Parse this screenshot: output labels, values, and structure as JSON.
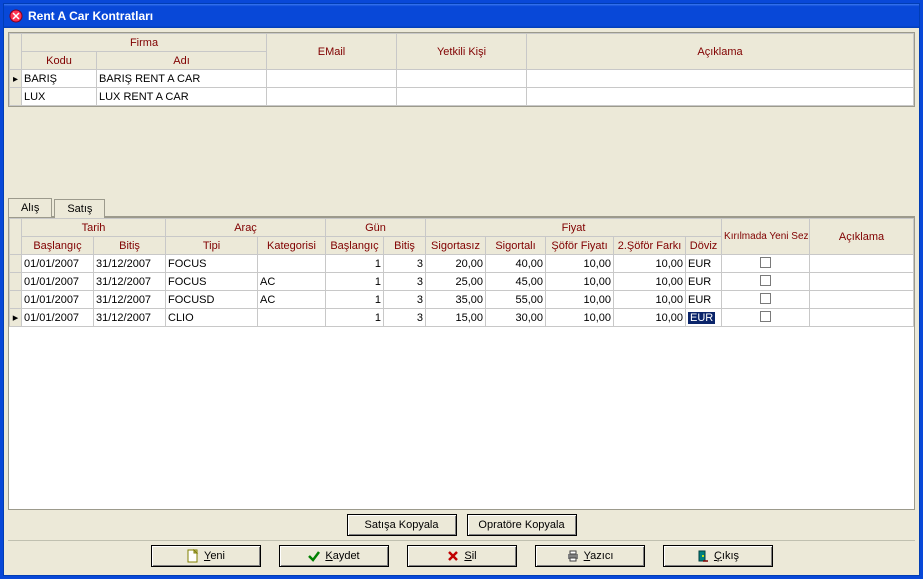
{
  "window": {
    "title": "Rent A Car Kontratları"
  },
  "grid1": {
    "headers": {
      "firma": "Firma",
      "kodu": "Kodu",
      "adi": "Adı",
      "email": "EMail",
      "yetkili": "Yetkili Kişi",
      "aciklama": "Açıklama"
    },
    "rows": [
      {
        "selected": true,
        "kodu": "BARIŞ",
        "adi": "BARIŞ RENT A CAR",
        "email": "",
        "yetkili": "",
        "aciklama": ""
      },
      {
        "selected": false,
        "kodu": "LUX",
        "adi": "LUX RENT A CAR",
        "email": "",
        "yetkili": "",
        "aciklama": ""
      }
    ]
  },
  "tabs": {
    "alis": "Alış",
    "satis": "Satış"
  },
  "grid2": {
    "headers": {
      "tarih": "Tarih",
      "baslangic": "Başlangıç",
      "bitis": "Bitiş",
      "arac": "Araç",
      "tipi": "Tipi",
      "kategorisi": "Kategorisi",
      "gun": "Gün",
      "fiyat": "Fiyat",
      "sigortasiz": "Sigortasız",
      "sigortali": "Sigortalı",
      "sofor": "Şöför Fiyatı",
      "sofor2": "2.Şöför Farkı",
      "doviz": "Döviz",
      "kirilma": "Kırılmada Yeni Sezon Fiyatı Geçerli Olsun",
      "aciklama": "Açıklama"
    },
    "rows": [
      {
        "selected": false,
        "bas": "01/01/2007",
        "bit": "31/12/2007",
        "tipi": "FOCUS",
        "kat": "",
        "gbas": "1",
        "gbit": "3",
        "sigortasiz": "20,00",
        "sigortali": "40,00",
        "sofor": "10,00",
        "sofor2": "10,00",
        "doviz": "EUR",
        "kirilma": false,
        "sel_doviz": false
      },
      {
        "selected": false,
        "bas": "01/01/2007",
        "bit": "31/12/2007",
        "tipi": "FOCUS",
        "kat": "AC",
        "gbas": "1",
        "gbit": "3",
        "sigortasiz": "25,00",
        "sigortali": "45,00",
        "sofor": "10,00",
        "sofor2": "10,00",
        "doviz": "EUR",
        "kirilma": false,
        "sel_doviz": false
      },
      {
        "selected": false,
        "bas": "01/01/2007",
        "bit": "31/12/2007",
        "tipi": "FOCUSD",
        "kat": "AC",
        "gbas": "1",
        "gbit": "3",
        "sigortasiz": "35,00",
        "sigortali": "55,00",
        "sofor": "10,00",
        "sofor2": "10,00",
        "doviz": "EUR",
        "kirilma": false,
        "sel_doviz": false
      },
      {
        "selected": true,
        "bas": "01/01/2007",
        "bit": "31/12/2007",
        "tipi": "CLIO",
        "kat": "",
        "gbas": "1",
        "gbit": "3",
        "sigortasiz": "15,00",
        "sigortali": "30,00",
        "sofor": "10,00",
        "sofor2": "10,00",
        "doviz": "EUR",
        "kirilma": false,
        "sel_doviz": true
      }
    ]
  },
  "buttons": {
    "satisa_kopyala": "Satışa Kopyala",
    "opratore_kopyala": "Opratöre Kopyala",
    "yeni": "Yeni",
    "kaydet": "Kaydet",
    "sil": "Sil",
    "yazici": "Yazıcı",
    "cikis": "Çıkış"
  }
}
